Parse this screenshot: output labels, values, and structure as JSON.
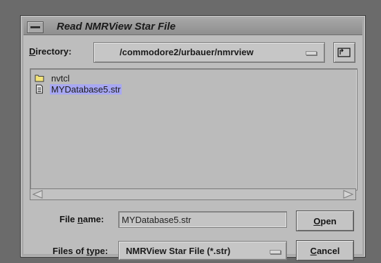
{
  "dialog": {
    "title": "Read NMRView Star File"
  },
  "directory": {
    "label_first": "D",
    "label_rest": "irectory:",
    "path": "/commodore2/urbauer/nmrview"
  },
  "files": [
    {
      "name": "nvtcl",
      "icon": "folder-icon",
      "selected": false
    },
    {
      "name": "MYDatabase5.str",
      "icon": "document-icon",
      "selected": true
    }
  ],
  "file_name": {
    "label_pre": "File ",
    "label_ul": "n",
    "label_post": "ame:",
    "value": "MYDatabase5.str"
  },
  "file_type": {
    "label_pre": "Files of ",
    "label_ul": "t",
    "label_post": "ype:",
    "value": "NMRView Star File (*.str)"
  },
  "buttons": {
    "open_ul": "O",
    "open_rest": "pen",
    "cancel_ul": "C",
    "cancel_rest": "ancel"
  },
  "colors": {
    "selection": "#a8a8f2",
    "background": "#bdbdbd"
  }
}
